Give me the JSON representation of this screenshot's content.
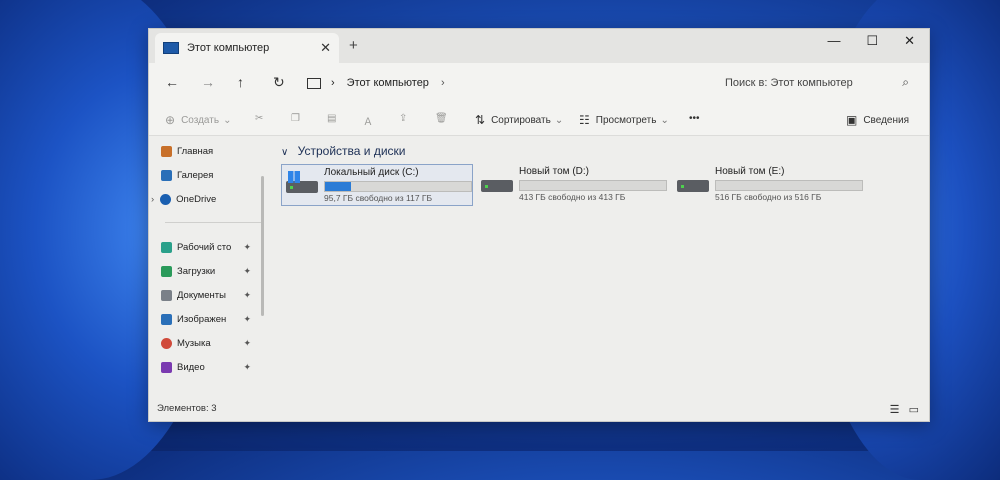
{
  "window": {
    "tab_title": "Этот компьютер",
    "tab_close": "✕",
    "new_tab": "+",
    "minimize": "—",
    "maximize": "☐",
    "close": "✕"
  },
  "nav": {
    "back": "←",
    "forward": "→",
    "up": "↑",
    "refresh": "↻",
    "breadcrumb_sep": "›",
    "breadcrumb_location": "Этот компьютер",
    "search_placeholder": "Поиск в: Этот компьютер",
    "search_icon": "⌕"
  },
  "toolbar": {
    "create": "Создать",
    "sort": "Сортировать",
    "view": "Просмотреть",
    "more": "•••",
    "details": "Сведения",
    "icons": [
      "plus-icon",
      "cut-icon",
      "copy-icon",
      "paste-icon",
      "rename-icon",
      "share-icon",
      "delete-icon"
    ]
  },
  "sidebar": {
    "items": [
      {
        "label": "Главная",
        "icon": "home-icon",
        "color": "#c8702a"
      },
      {
        "label": "Галерея",
        "icon": "gallery-icon",
        "color": "#2a6fb8"
      },
      {
        "label": "OneDrive",
        "icon": "cloud-icon",
        "color": "#1a5fb0"
      },
      {
        "label": "Рабочий сто",
        "icon": "desktop-icon",
        "color": "#2aa08a"
      },
      {
        "label": "Загрузки",
        "icon": "download-icon",
        "color": "#2a9a5a"
      },
      {
        "label": "Документы",
        "icon": "documents-icon",
        "color": "#7a8088"
      },
      {
        "label": "Изображен",
        "icon": "pictures-icon",
        "color": "#2a6fb8"
      },
      {
        "label": "Музыка",
        "icon": "music-icon",
        "color": "#d04a3a"
      },
      {
        "label": "Видео",
        "icon": "video-icon",
        "color": "#7a3ab0"
      }
    ],
    "onedrive_chevron": "›",
    "pin": "📌"
  },
  "main": {
    "section_chevron": "∨",
    "section_title": "Устройства и диски",
    "drives": [
      {
        "name": "Локальный диск (C:)",
        "free": "95,7 ГБ свободно из 117 ГБ",
        "used_fraction": 0.18,
        "system": true
      },
      {
        "name": "Новый том (D:)",
        "free": "413 ГБ свободно из 413 ГБ",
        "used_fraction": 0.0,
        "system": false
      },
      {
        "name": "Новый том (E:)",
        "free": "516 ГБ свободно из 516 ГБ",
        "used_fraction": 0.0,
        "system": false
      }
    ]
  },
  "status": {
    "items_count": "Элементов: 3",
    "view_list_icon": "☰",
    "view_tiles_icon": "▭"
  },
  "colors": {
    "accent": "#2a7bd6",
    "wallpaper": "#1b4fb8"
  }
}
